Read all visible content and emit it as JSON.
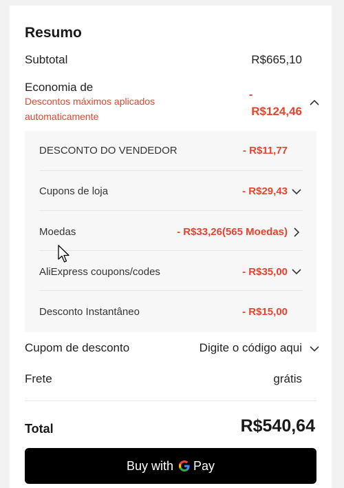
{
  "summary": {
    "title": "Resumo",
    "subtotal_label": "Subtotal",
    "subtotal_value": "R$665,10",
    "savings_label": "Economia de",
    "savings_note": "Descontos máximos aplicados automaticamente",
    "savings_sign": "-",
    "savings_value": "R$124,46",
    "discounts": [
      {
        "label": "DESCONTO DO VENDEDOR",
        "value": "- R$11,77"
      },
      {
        "label": "Cupons de loja",
        "value": "- R$29,43"
      },
      {
        "label": "Moedas",
        "value": "- R$33,26(565 Moedas)"
      },
      {
        "label": "AliExpress coupons/codes",
        "value": "- R$35,00"
      },
      {
        "label": "Desconto Instantâneo",
        "value": "- R$15,00"
      }
    ],
    "coupon_label": "Cupom de desconto",
    "coupon_placeholder": "Digite o código aqui",
    "shipping_label": "Frete",
    "shipping_value": "grátis",
    "total_label": "Total",
    "total_value": "R$540,64"
  },
  "pay_button": {
    "prefix": "Buy with",
    "brand": "Pay"
  },
  "colors": {
    "accent_red": "#e8432e",
    "button_bg": "#000000",
    "panel_bg": "#f7f7f7"
  }
}
